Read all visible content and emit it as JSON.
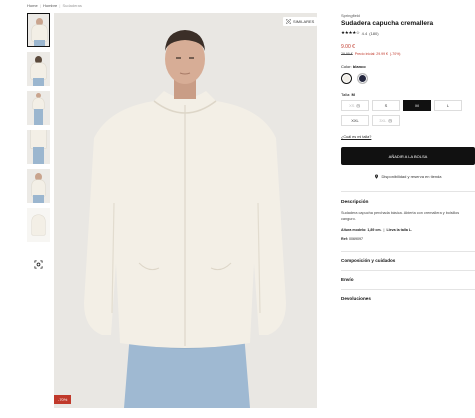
{
  "breadcrumb": {
    "home": "Home",
    "section": "Hombre",
    "current": "Sudaderas"
  },
  "gallery": {
    "thumbnails": [
      "front",
      "back",
      "full-body",
      "legs",
      "side",
      "garment",
      "visual-search"
    ],
    "similar_label": "SIMILARES",
    "discount_badge": "-70%"
  },
  "product": {
    "brand": "Springfield",
    "name": "Sudadera capucha cremallera",
    "stars": "★★★★☆",
    "rating": "4.4",
    "reviews": "(180)",
    "price": "9.00 €",
    "old_price": "29.99 €",
    "first_price": "Precio inicial: 29.99 €",
    "discount": "(-70%)",
    "color_label": "Color:",
    "color_value": "blanco",
    "colors": [
      "#f1eee7",
      "#25283f"
    ],
    "size_label": "Talla:",
    "size_value": "M",
    "sizes": [
      "XS",
      "S",
      "M",
      "L",
      "XXL",
      "3XL"
    ],
    "size_guide": "¿Cuál es mi talla?",
    "add_to_bag": "AÑADIR A LA BOLSA",
    "store_availability": "Disponibilidad y reserva en tienda",
    "accent": "#c0392b"
  },
  "description": {
    "title": "Descripción",
    "text": "Sudadera capucha perchada básica. Abierta con cremallera y bolsillos canguro.",
    "model_label": "Altura modelo:",
    "model_height": "1,89 cm.",
    "model_size": "Lleva la talla L.",
    "ref_label": "Ref:",
    "ref_value": "0069097"
  },
  "accordions": [
    "Composición y cuidados",
    "Envío",
    "Devoluciones"
  ]
}
